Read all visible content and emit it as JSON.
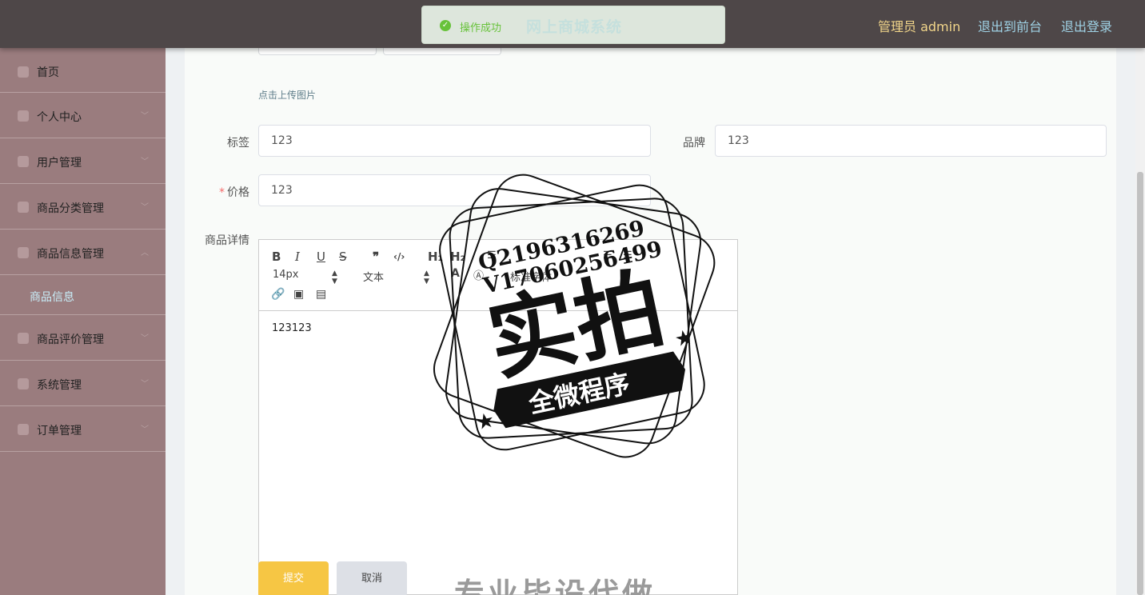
{
  "header": {
    "title": "网上商城系统",
    "admin_label": "管理员 admin",
    "to_front": "退出到前台",
    "logout": "退出登录"
  },
  "toast": {
    "message": "操作成功"
  },
  "sidebar": {
    "items": [
      {
        "label": "首页",
        "icon": "home-icon"
      },
      {
        "label": "个人中心",
        "icon": "user-icon"
      },
      {
        "label": "用户管理",
        "icon": "phone-icon"
      },
      {
        "label": "商品分类管理",
        "icon": "category-icon"
      },
      {
        "label": "商品信息管理",
        "icon": "goods-icon"
      },
      {
        "label": "商品评价管理",
        "icon": "comment-icon"
      },
      {
        "label": "系统管理",
        "icon": "briefcase-icon"
      },
      {
        "label": "订单管理",
        "icon": "order-icon"
      }
    ],
    "sub_item": "商品信息"
  },
  "form": {
    "upload_tip": "点击上传图片",
    "tag_label": "标签",
    "tag_value": "123",
    "brand_label": "品牌",
    "brand_value": "123",
    "price_required": "*",
    "price_label": "价格",
    "price_value": "123",
    "detail_label": "商品详情"
  },
  "editor": {
    "bold": "B",
    "italic": "I",
    "underline": "U",
    "strike": "S",
    "quote": "❞",
    "code": "‹/›",
    "h1": "H₁",
    "h2": "H₂",
    "font_size": "14px",
    "text_type": "文本",
    "font_family": "标准字体",
    "content": "123123"
  },
  "buttons": {
    "submit": "提交",
    "cancel": "取消"
  },
  "watermark": {
    "qq": "Q2196316269",
    "wechat": "V17060256499",
    "main": "实拍",
    "banner": "全微程序",
    "bottom": "专业毕设代做"
  },
  "colors": {
    "topbar": "#4e4748",
    "sidebar": "#9a7c7e",
    "submit": "#f6c644",
    "success": "#67c23a",
    "active_submenu": "#c8eef9"
  }
}
